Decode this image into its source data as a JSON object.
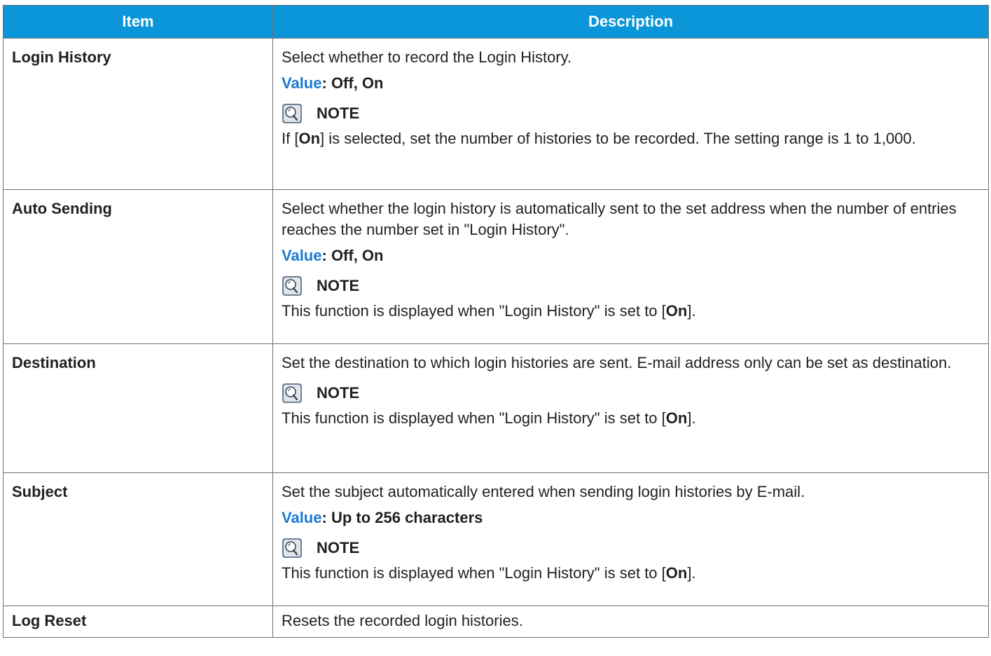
{
  "table": {
    "headers": [
      "Item",
      "Description"
    ],
    "note_label": "NOTE",
    "value_label": "Value",
    "rows": [
      {
        "item": "Login History",
        "desc": "Select whether to record the Login History.",
        "value": "Off, On",
        "note_pre": "If [",
        "note_bold": "On",
        "note_post": "] is selected, set the number of histories to be recorded. The setting range is 1 to 1,000."
      },
      {
        "item": "Auto Sending",
        "desc": "Select whether the login history is automatically sent to the set address when the number of entries reaches the number set in \"Login History\".",
        "value": "Off, On",
        "note_pre": "This function is displayed when \"Login History\" is set to [",
        "note_bold": "On",
        "note_post": "]."
      },
      {
        "item": "Destination",
        "desc": "Set the destination to which login histories are sent. E-mail address only can be set as destination.",
        "note_pre": "This function is displayed when \"Login History\" is set to [",
        "note_bold": "On",
        "note_post": "]."
      },
      {
        "item": "Subject",
        "desc": "Set the subject automatically entered when sending login histories by E-mail.",
        "value": "Up to 256 characters",
        "note_pre": "This function is displayed when \"Login History\" is set to [",
        "note_bold": "On",
        "note_post": "]."
      },
      {
        "item": "Log Reset",
        "desc": "Resets the recorded login histories."
      }
    ]
  },
  "colors": {
    "header_bg": "#0a96d8",
    "value_label": "#1a7ad4",
    "border": "#6f6f6f"
  },
  "icons": {
    "note": "note-lightbulb-icon"
  }
}
